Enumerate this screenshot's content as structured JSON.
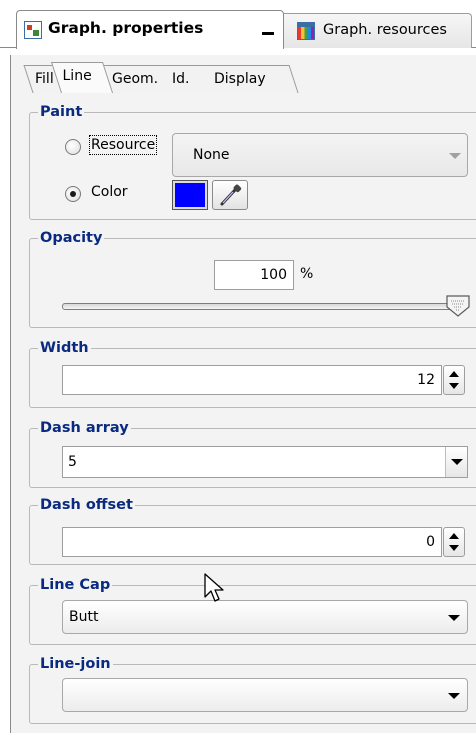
{
  "view_tabs": [
    {
      "label": "Graph. properties",
      "icon": "properties-icon",
      "active": true
    },
    {
      "label": "Graph. resources",
      "icon": "palette-icon",
      "active": false
    }
  ],
  "subtabs": [
    "Fill",
    "Line",
    "Geom.",
    "Id.",
    "Display"
  ],
  "active_subtab": "Line",
  "paint": {
    "legend": "Paint",
    "resource_label": "Resource",
    "resource_value": "None",
    "color_label": "Color",
    "selected_option": "Color",
    "color_value": "#0000ff"
  },
  "opacity": {
    "legend": "Opacity",
    "value": "100",
    "unit": "%",
    "slider_level": 1.0
  },
  "width": {
    "legend": "Width",
    "value": "12"
  },
  "dash_array": {
    "legend": "Dash array",
    "value": "5"
  },
  "dash_offset": {
    "legend": "Dash offset",
    "value": "0"
  },
  "line_cap": {
    "legend": "Line Cap",
    "value": "Butt"
  },
  "line_join": {
    "legend": "Line-join",
    "value": ""
  },
  "colors": {
    "legend_text": "#0a2a80",
    "swatch": "#0000ff"
  }
}
